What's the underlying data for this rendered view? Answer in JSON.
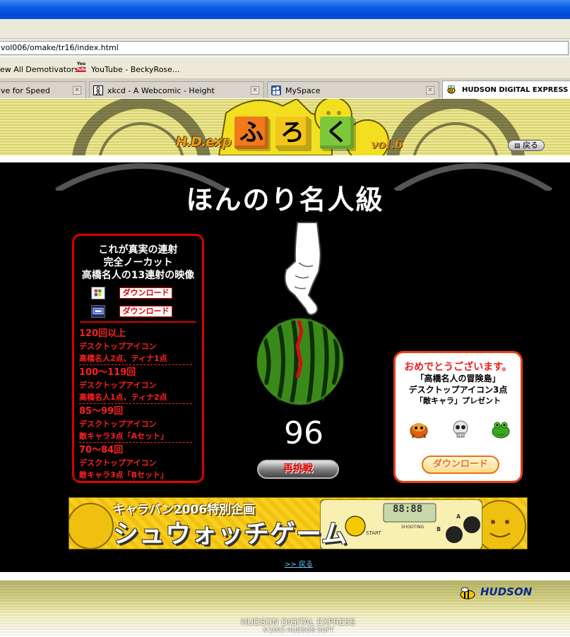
{
  "browser": {
    "address": "vol006/omake/tr16/index.html",
    "bookmarks": [
      "ew All Demotivators®",
      "YouTube - BeckyRose..."
    ],
    "tabs": [
      {
        "label": "ve for Speed"
      },
      {
        "label": "xkcd - A Webcomic - Height"
      },
      {
        "label": "MySpace"
      },
      {
        "label": "HUDSON DIGITAL EXPRESS",
        "active": true
      }
    ]
  },
  "header": {
    "brand": "H.D.exp",
    "furoku_chars": [
      "ふ",
      "ろ",
      "く"
    ],
    "furoku_colors": [
      "#f07a1a",
      "#f2c61a",
      "#7cc83a"
    ],
    "volume": "vol.6",
    "back_label": "戻る"
  },
  "main": {
    "heading": "ほんのり名人級",
    "left_panel": {
      "title_lines": [
        "これが真実の連射",
        "完全ノーカット",
        "高橋名人の13連射の映像"
      ],
      "download_label": "ダウンロード",
      "tiers": [
        {
          "title": "120回以上",
          "sub": "デスクトップアイコン",
          "detail": "高橋名人2点、ティナ1点"
        },
        {
          "title": "100〜119回",
          "sub": "デスクトップアイコン",
          "detail": "高橋名人1点、ティナ2点"
        },
        {
          "title": "85〜99回",
          "sub": "デスクトップアイコン",
          "detail": "敵キャラ3点「Aセット」"
        },
        {
          "title": "70〜84回",
          "sub": "デスクトップアイコン",
          "detail": "敵キャラ3点「Bセット」"
        }
      ]
    },
    "score": "96",
    "retry_label": "再挑戦",
    "right_panel": {
      "congrats": "おめでとうございます。",
      "lines": [
        "「高橋名人の冒険島」",
        "デスクトップアイコン3点",
        "「敵キャラ」プレゼント"
      ],
      "download_label": "ダウンロード"
    },
    "banner": {
      "sub": "キャラバン2006特別企画",
      "main": "シュウォッチゲーム",
      "device_lcd": "88:88",
      "device_labels": [
        "START",
        "SHOOTING",
        "B",
        "A"
      ]
    },
    "back_link": ">> 戻る"
  },
  "footer": {
    "logo": "HUDSON",
    "name": "HUDSON DIGITAL EXPRESS",
    "copyright": "©2003 HUDSON SOFT"
  },
  "colors": {
    "accent_red": "#d80000",
    "xp_blue": "#0a5ce6",
    "header_yellow": "#e3dd80"
  }
}
